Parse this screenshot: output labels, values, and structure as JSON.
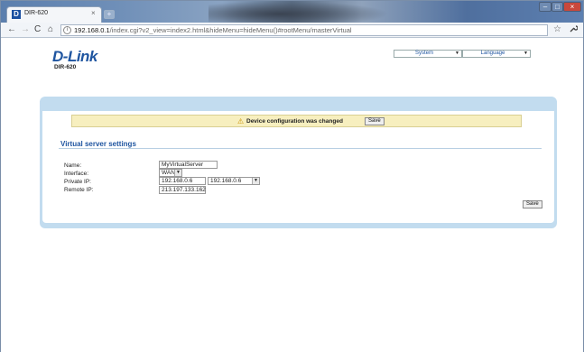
{
  "browser": {
    "tab_title": "DIR-620",
    "tab_close": "×",
    "favicon_letter": "D",
    "new_tab": "+",
    "url_host": "192.168.0.1",
    "url_path": "/index.cgi?v2_view=index2.html&hideMenu=hideMenu()#rootMenu/masterVirtual",
    "controls": {
      "minimize": "–",
      "maximize": "□",
      "close": "×"
    },
    "nav": {
      "back": "←",
      "forward": "→",
      "reload": "C",
      "home": "⌂",
      "star": "☆",
      "wrench": "🔧"
    }
  },
  "header": {
    "logo": "D-Link",
    "model": "DIR-620",
    "menus": [
      {
        "label": "System",
        "arrow": "▼"
      },
      {
        "label": "Language",
        "arrow": "▼"
      }
    ]
  },
  "notice": {
    "icon": "⚠",
    "text": "Device configuration was changed",
    "button": "Save"
  },
  "form": {
    "title": "Virtual server settings",
    "name_label": "Name:",
    "name_value": "MyVirtualServer",
    "interface_label": "Interface:",
    "interface_value": "WAN",
    "private_ip_label": "Private IP:",
    "private_ip_value": "192.168.0.6",
    "private_ip_select": "192.168.0.6",
    "remote_ip_label": "Remote IP:",
    "remote_ip_value": "213.197.133.162",
    "save_label": "Save",
    "select_arrow": "▼"
  }
}
